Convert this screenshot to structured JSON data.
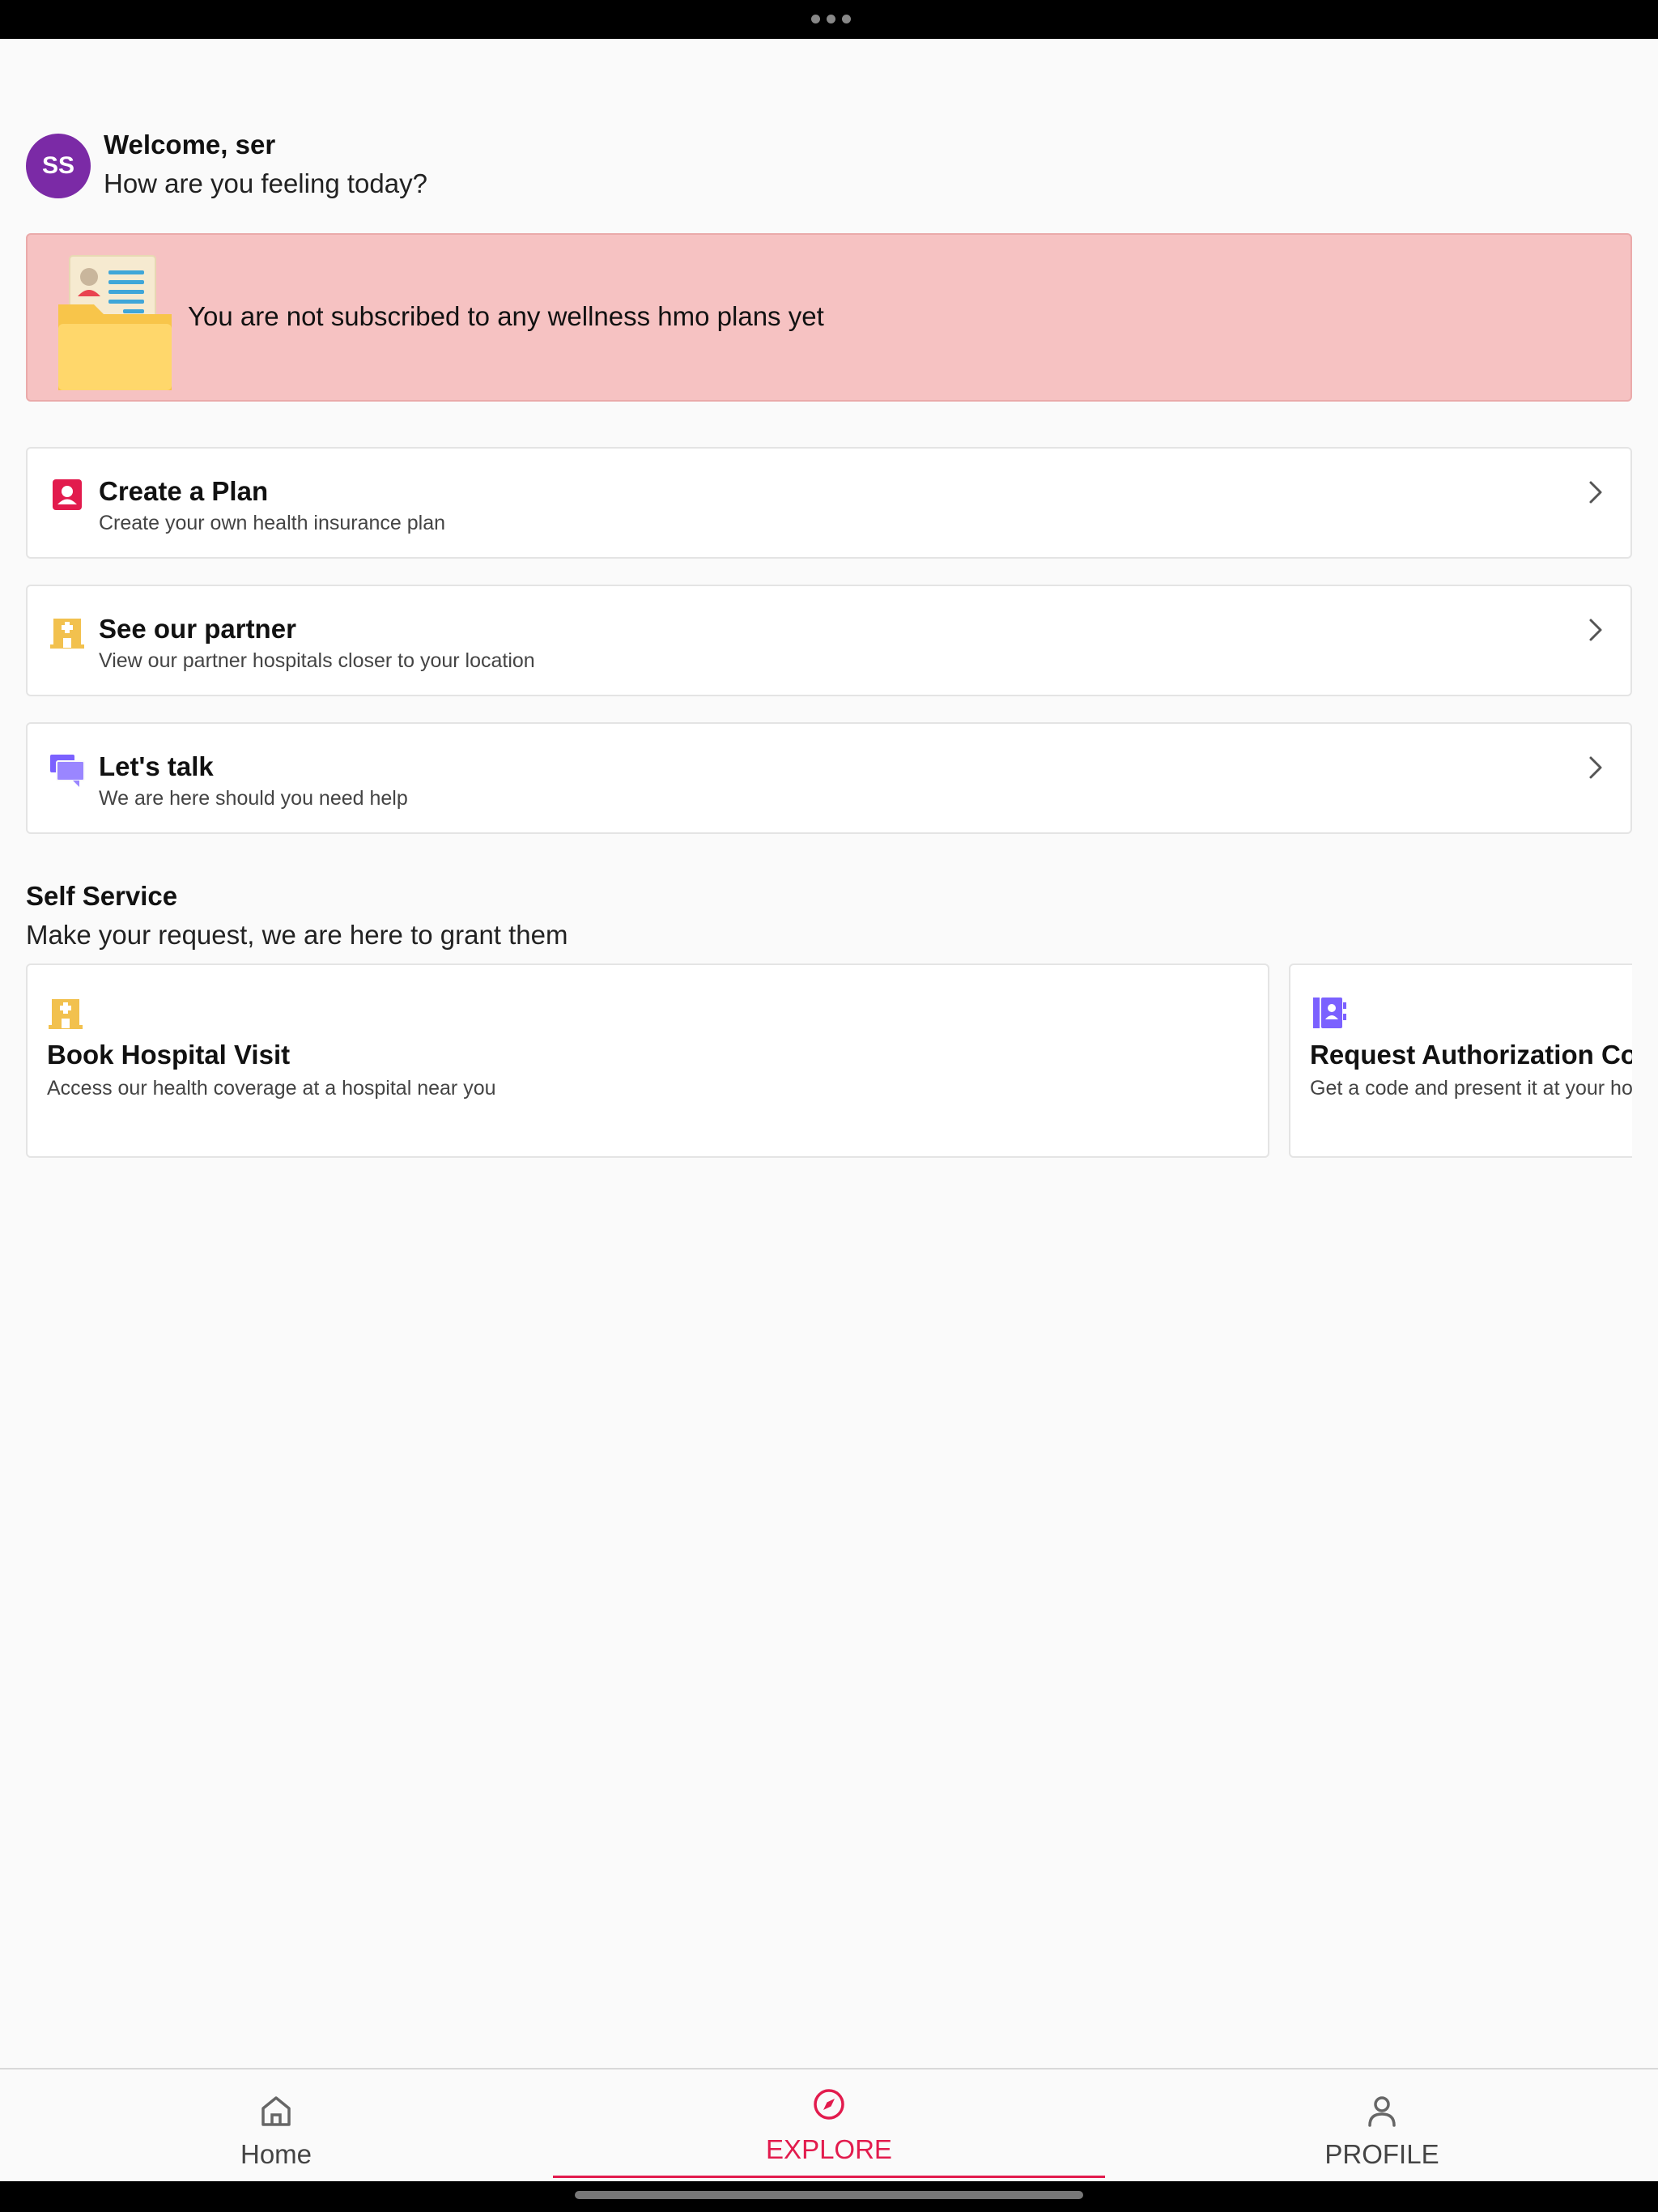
{
  "header": {
    "avatar_initials": "SS",
    "welcome": "Welcome, ser",
    "subtitle": "How are you feeling today?"
  },
  "banner": {
    "text": "You are not subscribed to any wellness hmo plans yet",
    "illustration": "folder-document-icon"
  },
  "actions": [
    {
      "title": "Create a Plan",
      "subtitle": "Create your own health insurance plan",
      "icon": "person-badge-icon",
      "color": "#e21b4d"
    },
    {
      "title": "See our partner",
      "subtitle": "View our partner hospitals closer to your location",
      "icon": "hospital-icon",
      "color": "#f2c14e"
    },
    {
      "title": "Let's talk",
      "subtitle": "We are here should you need help",
      "icon": "chat-icon",
      "color": "#7b61ff"
    }
  ],
  "self_service": {
    "title": "Self Service",
    "subtitle": "Make your request, we are here to grant them",
    "cards": [
      {
        "title": "Book Hospital Visit",
        "subtitle": "Access our health coverage at a hospital near you",
        "icon": "hospital-icon"
      },
      {
        "title": "Request Authorization Cod",
        "subtitle": "Get a code and present it at your ho",
        "icon": "contact-book-icon"
      }
    ]
  },
  "nav": {
    "items": [
      {
        "label": "Home",
        "icon": "home-icon"
      },
      {
        "label": "EXPLORE",
        "icon": "compass-icon",
        "active": true
      },
      {
        "label": "PROFILE",
        "icon": "person-icon"
      }
    ]
  },
  "colors": {
    "accent": "#e21b4d",
    "avatar": "#7b2aa6",
    "banner_bg": "#f6c2c2",
    "yellow_icon": "#f2c14e",
    "purple_icon": "#7b61ff"
  }
}
